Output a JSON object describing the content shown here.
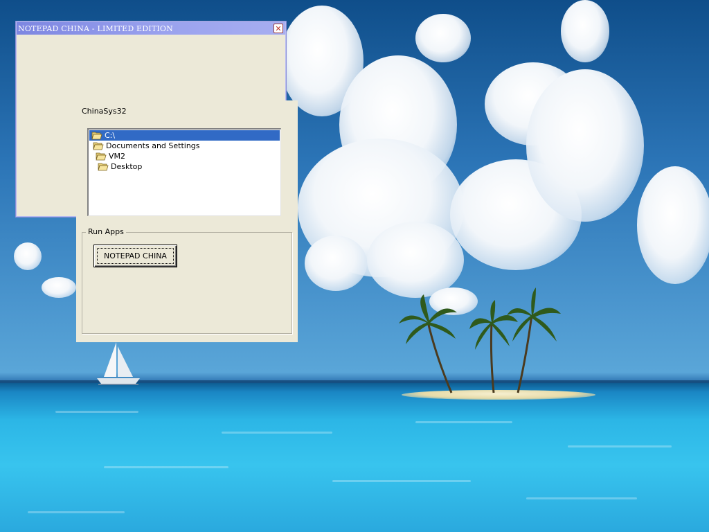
{
  "desktop": {
    "wallpaper": "tropical-island-sea-wallpaper",
    "colors": {
      "sky": "#2b74b6",
      "sea": "#2cb6e6",
      "sand": "#efe6c0"
    }
  },
  "notepad_window": {
    "title": "NOTEPAD CHINA - LIMITED EDITION",
    "close_icon": "close-icon",
    "colors": {
      "titlebar": "#8a92e6",
      "body": "#ece9d8"
    }
  },
  "chinasys_panel": {
    "label": "ChinaSys32",
    "tree": {
      "items": [
        {
          "label": "C:\\",
          "icon": "folder-open-icon",
          "selected": true
        },
        {
          "label": "Documents and Settings",
          "icon": "folder-open-icon",
          "selected": false
        },
        {
          "label": "VM2",
          "icon": "folder-open-icon",
          "selected": false
        },
        {
          "label": "Desktop",
          "icon": "folder-open-icon",
          "selected": false
        }
      ],
      "selection_color": "#316ac5"
    },
    "run_apps": {
      "label": "Run Apps",
      "buttons": [
        {
          "label": "NOTEPAD CHINA"
        }
      ]
    }
  }
}
